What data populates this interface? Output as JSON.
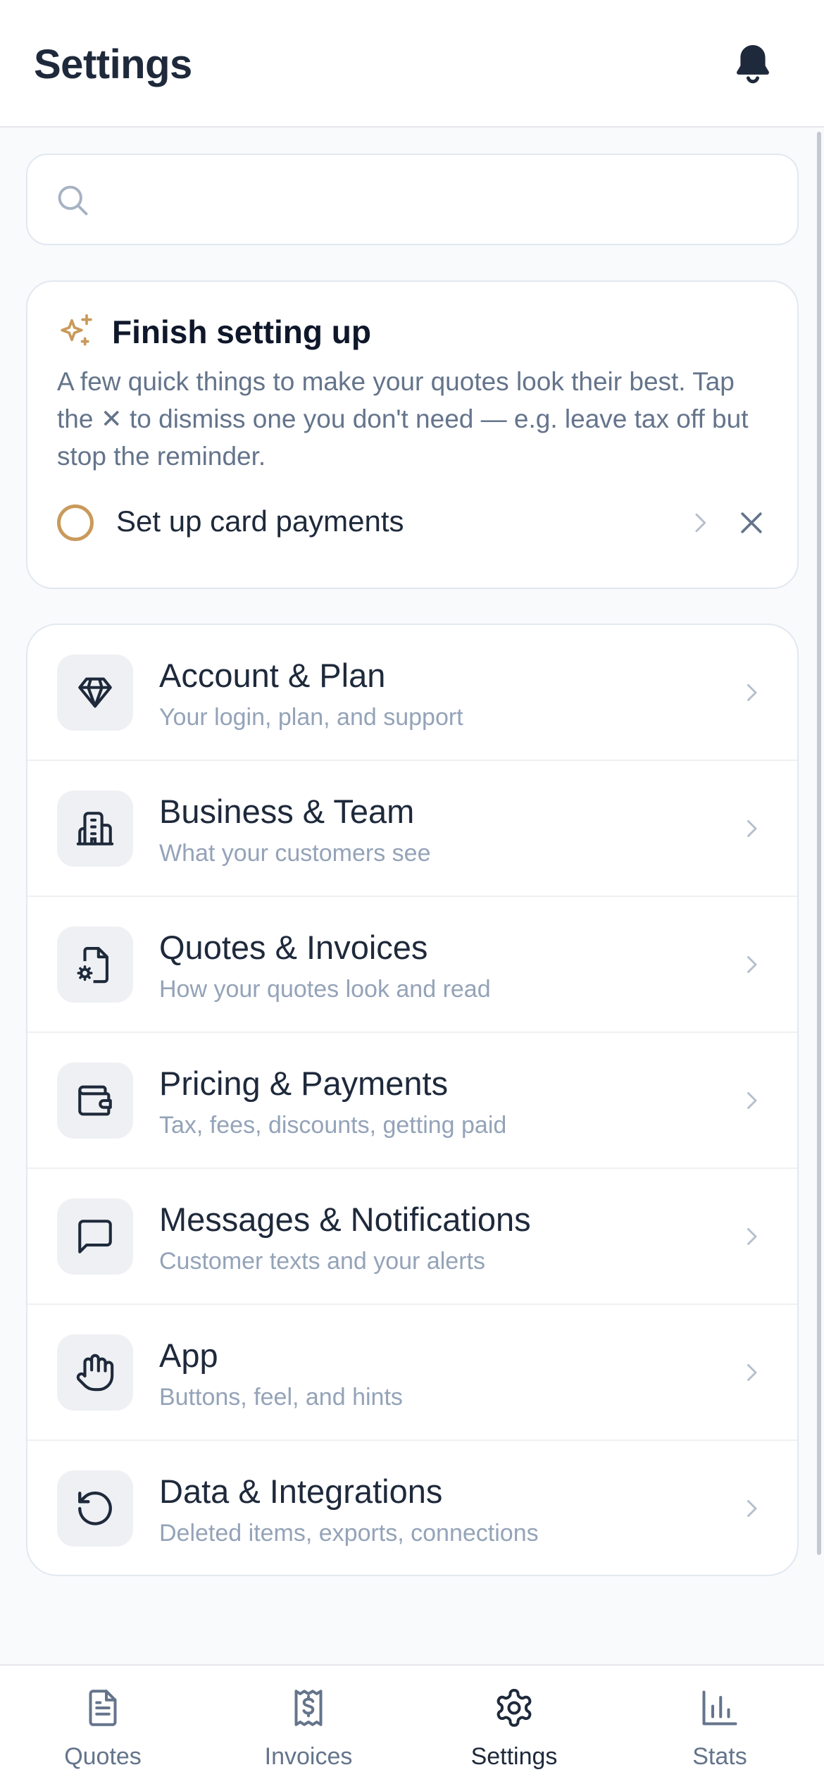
{
  "header": {
    "title": "Settings",
    "notification_icon": "bell-icon"
  },
  "search": {
    "placeholder": "",
    "value": "",
    "icon": "search-icon"
  },
  "setup": {
    "title": "Finish setting up",
    "description": "A few quick things to make your quotes look their best. Tap the ✕ to dismiss one you don't need — e.g. leave tax off but stop the reminder.",
    "icon": "sparkle-icon",
    "accent_color": "#c99a5b",
    "tasks": [
      {
        "label": "Set up card payments",
        "completed": false
      }
    ]
  },
  "settings_list": {
    "items": [
      {
        "title": "Account & Plan",
        "subtitle": "Your login, plan, and support",
        "icon": "diamond-icon"
      },
      {
        "title": "Business & Team",
        "subtitle": "What your customers see",
        "icon": "building-icon"
      },
      {
        "title": "Quotes & Invoices",
        "subtitle": "How your quotes look and read",
        "icon": "file-gear-icon"
      },
      {
        "title": "Pricing & Payments",
        "subtitle": "Tax, fees, discounts, getting paid",
        "icon": "wallet-icon"
      },
      {
        "title": "Messages & Notifications",
        "subtitle": "Customer texts and your alerts",
        "icon": "message-icon"
      },
      {
        "title": "App",
        "subtitle": "Buttons, feel, and hints",
        "icon": "hand-icon"
      },
      {
        "title": "Data & Integrations",
        "subtitle": "Deleted items, exports, connections",
        "icon": "history-icon"
      }
    ]
  },
  "tabbar": {
    "active": "Settings",
    "tabs": [
      {
        "label": "Quotes",
        "icon": "document-icon"
      },
      {
        "label": "Invoices",
        "icon": "receipt-icon"
      },
      {
        "label": "Settings",
        "icon": "gear-icon"
      },
      {
        "label": "Stats",
        "icon": "bar-chart-icon"
      }
    ]
  },
  "colors": {
    "text_primary": "#1e293b",
    "text_secondary": "#64748b",
    "text_muted": "#94a3b8",
    "border": "#e2e8f0",
    "icon_bg": "#eef0f3",
    "accent": "#c99a5b"
  }
}
